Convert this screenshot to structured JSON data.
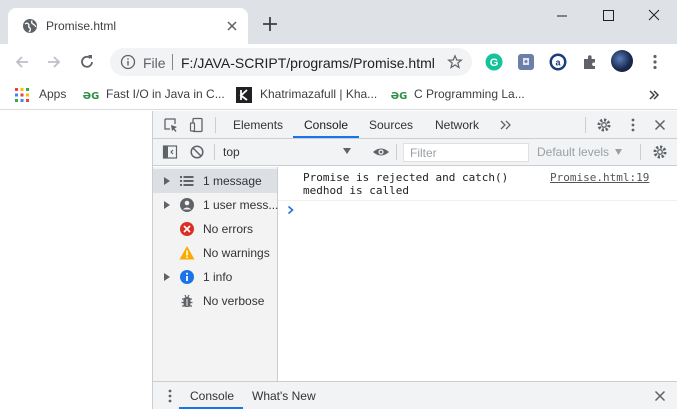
{
  "tab": {
    "title": "Promise.html"
  },
  "omnibox": {
    "scheme": "File",
    "url": "F:/JAVA-SCRIPT/programs/Promise.html"
  },
  "bookmarks": [
    {
      "label": "Apps",
      "icon": "apps-grid-icon"
    },
    {
      "label": "Fast I/O in Java in C...",
      "icon": "gfg-icon"
    },
    {
      "label": "Khatrimazafull | Kha...",
      "icon": "k-icon"
    },
    {
      "label": "C Programming La...",
      "icon": "gfg-icon"
    }
  ],
  "devtools": {
    "tabs": [
      "Elements",
      "Console",
      "Sources",
      "Network"
    ],
    "active_tab": "Console",
    "context": "top",
    "filter_placeholder": "Filter",
    "levels": "Default levels",
    "sidebar": [
      {
        "label": "1 message",
        "icon": "list-icon",
        "expandable": true,
        "selected": true
      },
      {
        "label": "1 user mess...",
        "icon": "user-icon",
        "expandable": true
      },
      {
        "label": "No errors",
        "icon": "error-icon",
        "expandable": false
      },
      {
        "label": "No warnings",
        "icon": "warning-icon",
        "expandable": false
      },
      {
        "label": "1 info",
        "icon": "info-icon",
        "expandable": true
      },
      {
        "label": "No verbose",
        "icon": "bug-icon",
        "expandable": false
      }
    ],
    "message": {
      "text": "Promise is rejected and catch()\nmedhod is called",
      "source": "Promise.html:19"
    },
    "drawer_tabs": [
      "Console",
      "What's New"
    ]
  },
  "colors": {
    "accent": "#1a73e8",
    "tabstrip": "#dee1e6",
    "devtools_bar": "#f1f3f4",
    "error": "#d93025",
    "warning": "#f9ab00",
    "info": "#1a73e8"
  }
}
